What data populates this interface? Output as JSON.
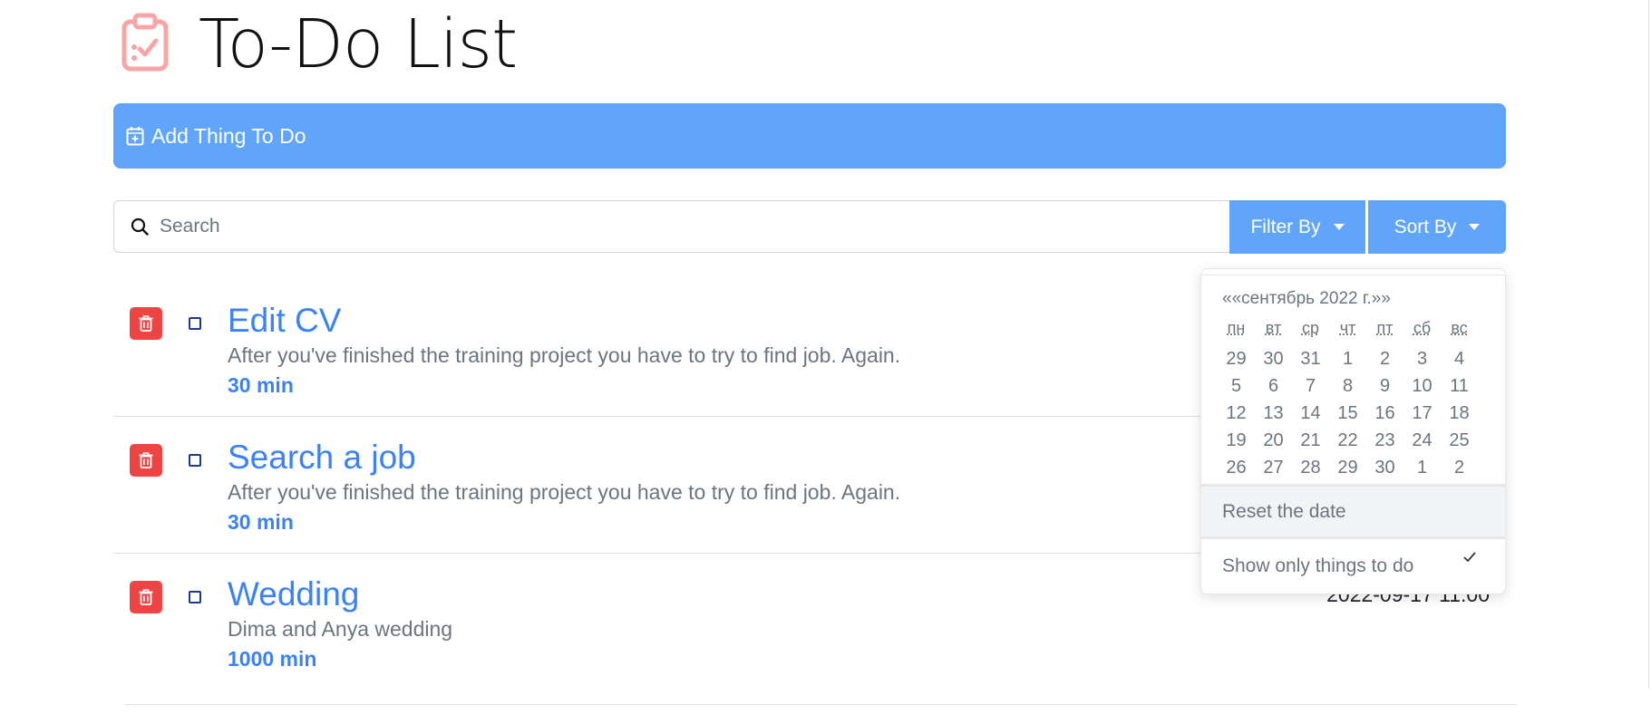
{
  "header": {
    "title": "To-Do List",
    "logo_icon": "clipboard-check-icon",
    "logo_color": "#f8a5a5"
  },
  "add_bar": {
    "label": "Add Thing To Do",
    "icon": "calendar-plus-icon",
    "color": "#60a5fa"
  },
  "search": {
    "placeholder": "Search",
    "value": "",
    "icon": "search-icon"
  },
  "filter": {
    "label": "Filter By"
  },
  "sort": {
    "label": "Sort By"
  },
  "todos": [
    {
      "title": "Edit CV",
      "description": "After you've finished the training project you have to try to find job. Again.",
      "duration": "30 min",
      "date": ""
    },
    {
      "title": "Search a job",
      "description": "After you've finished the training project you have to try to find job. Again.",
      "duration": "30 min",
      "date": ""
    },
    {
      "title": "Wedding",
      "description": "Dima and Anya wedding",
      "duration": "1000 min",
      "date": "2022-09-17 11:00"
    }
  ],
  "dropdown": {
    "calendar": {
      "header": "««сентябрь 2022 г.»»",
      "weekdays": [
        "пн",
        "вт",
        "ср",
        "чт",
        "пт",
        "сб",
        "вс"
      ],
      "days": [
        [
          "29",
          "30",
          "31",
          "1",
          "2",
          "3",
          "4"
        ],
        [
          "5",
          "6",
          "7",
          "8",
          "9",
          "10",
          "11"
        ],
        [
          "12",
          "13",
          "14",
          "15",
          "16",
          "17",
          "18"
        ],
        [
          "19",
          "20",
          "21",
          "22",
          "23",
          "24",
          "25"
        ],
        [
          "26",
          "27",
          "28",
          "29",
          "30",
          "1",
          "2"
        ]
      ]
    },
    "reset_label": "Reset the date",
    "show_only_label": "Show only things to do",
    "show_only_checked": true
  },
  "colors": {
    "accent": "#3b82f6",
    "button_blue": "#60a5fa",
    "danger": "#ef4444",
    "checkbox": "#1e3a8a"
  }
}
